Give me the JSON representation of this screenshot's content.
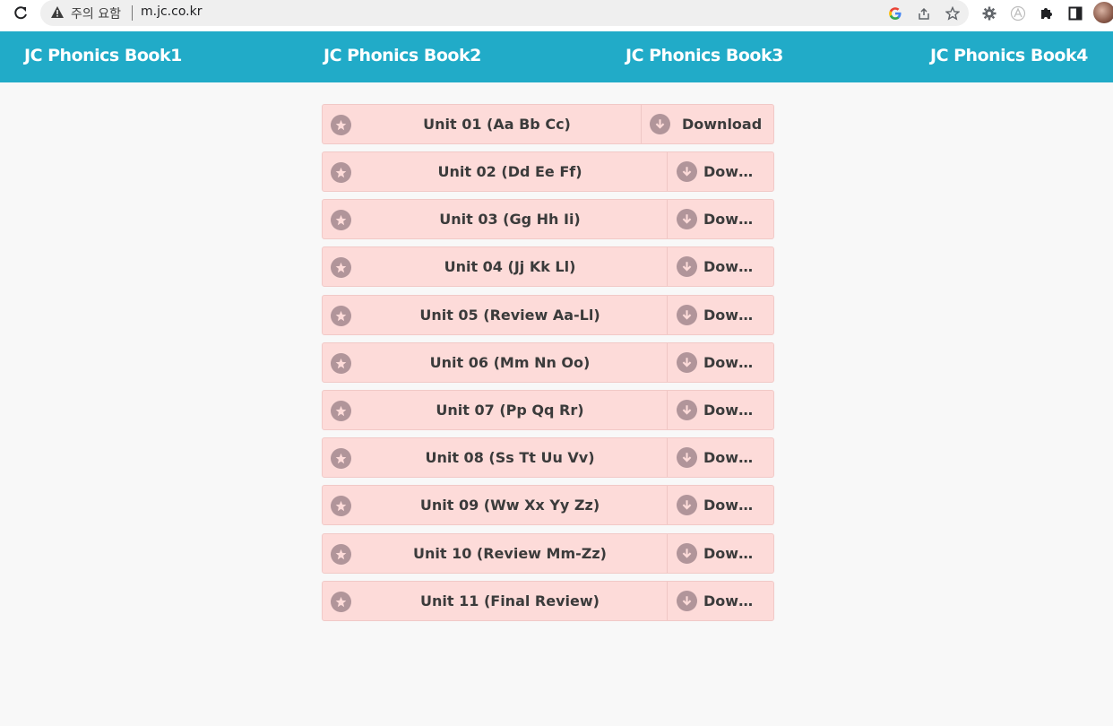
{
  "browser": {
    "security_label": "주의 요함",
    "url": "m.jc.co.kr"
  },
  "nav": {
    "items": [
      {
        "label": "JC Phonics Book1"
      },
      {
        "label": "JC Phonics Book2"
      },
      {
        "label": "JC Phonics Book3"
      },
      {
        "label": "JC Phonics Book4"
      }
    ]
  },
  "units": [
    {
      "title": "Unit 01 (Aa Bb Cc)",
      "download": "Download"
    },
    {
      "title": "Unit 02 (Dd Ee Ff)",
      "download": "Downl…"
    },
    {
      "title": "Unit 03 (Gg Hh Ii)",
      "download": "Downl…"
    },
    {
      "title": "Unit 04 (Jj Kk Ll)",
      "download": "Downl…"
    },
    {
      "title": "Unit 05 (Review Aa-Ll)",
      "download": "Downl…"
    },
    {
      "title": "Unit 06 (Mm Nn Oo)",
      "download": "Downl…"
    },
    {
      "title": "Unit 07 (Pp Qq Rr)",
      "download": "Downl…"
    },
    {
      "title": "Unit 08 (Ss Tt Uu Vv)",
      "download": "Downl…"
    },
    {
      "title": "Unit 09 (Ww Xx Yy Zz)",
      "download": "Downl…"
    },
    {
      "title": "Unit 10 (Review Mm-Zz)",
      "download": "Downl…"
    },
    {
      "title": "Unit 11 (Final Review)",
      "download": "Downl…"
    }
  ],
  "colors": {
    "navbar": "#21abc8",
    "row_bg": "#fddbd9",
    "icon_bg": "#b1959a",
    "page_bg": "#f8f8f8"
  }
}
